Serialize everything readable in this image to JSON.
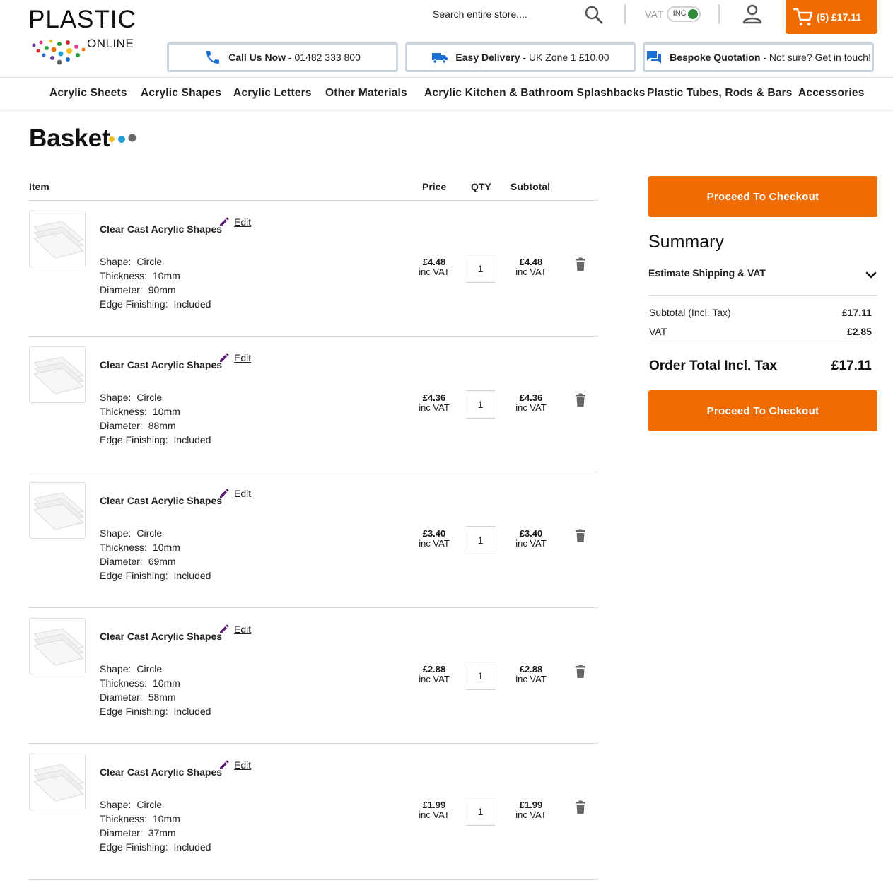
{
  "brand": {
    "name_top": "PLASTIC",
    "name_bottom": "ONLINE"
  },
  "header": {
    "search_placeholder": "Search entire store....",
    "vat_label": "VAT",
    "vat_toggle": "INC",
    "cart_label": "(5) £17.11"
  },
  "info": {
    "call_bold": "Call Us Now",
    "call_text": " - 01482 333 800",
    "delivery_bold": "Easy Delivery",
    "delivery_text": " - UK Zone 1 £10.00",
    "quote_bold": "Bespoke Quotation",
    "quote_text": " - Not sure? Get in touch!"
  },
  "nav": [
    "Acrylic Sheets",
    "Acrylic Shapes",
    "Acrylic Letters",
    "Other Materials",
    "Acrylic Kitchen & Bathroom Splashbacks",
    "Plastic Tubes, Rods & Bars",
    "Accessories"
  ],
  "page": {
    "title": "Basket"
  },
  "table": {
    "col_item": "Item",
    "col_price": "Price",
    "col_qty": "QTY",
    "col_subtotal": "Subtotal",
    "edit_label": "Edit",
    "inc_vat": "inc VAT",
    "attr_shape": "Shape:",
    "attr_thickness": "Thickness:",
    "attr_diameter": "Diameter:",
    "attr_edge": "Edge Finishing:"
  },
  "items": [
    {
      "name": "Clear Cast Acrylic Shapes",
      "shape": "Circle",
      "thickness": "10mm",
      "diameter": "90mm",
      "edge": "Included",
      "price": "£4.48",
      "qty": "1",
      "subtotal": "£4.48"
    },
    {
      "name": "Clear Cast Acrylic Shapes",
      "shape": "Circle",
      "thickness": "10mm",
      "diameter": "88mm",
      "edge": "Included",
      "price": "£4.36",
      "qty": "1",
      "subtotal": "£4.36"
    },
    {
      "name": "Clear Cast Acrylic Shapes",
      "shape": "Circle",
      "thickness": "10mm",
      "diameter": "69mm",
      "edge": "Included",
      "price": "£3.40",
      "qty": "1",
      "subtotal": "£3.40"
    },
    {
      "name": "Clear Cast Acrylic Shapes",
      "shape": "Circle",
      "thickness": "10mm",
      "diameter": "58mm",
      "edge": "Included",
      "price": "£2.88",
      "qty": "1",
      "subtotal": "£2.88"
    },
    {
      "name": "Clear Cast Acrylic Shapes",
      "shape": "Circle",
      "thickness": "10mm",
      "diameter": "37mm",
      "edge": "Included",
      "price": "£1.99",
      "qty": "1",
      "subtotal": "£1.99"
    }
  ],
  "summary": {
    "checkout_label": "Proceed To Checkout",
    "title": "Summary",
    "shipping_label": "Estimate Shipping & VAT",
    "subtotal_label": "Subtotal (Incl. Tax)",
    "subtotal_value": "£17.11",
    "vat_label": "VAT",
    "vat_value": "£2.85",
    "total_label": "Order Total Incl. Tax",
    "total_value": "£17.11"
  },
  "colors": {
    "accent": "#f06b00",
    "toggle_on": "#2e8b3a",
    "edit_icon": "#5a1a78",
    "info_icon": "#1d6fd6"
  }
}
